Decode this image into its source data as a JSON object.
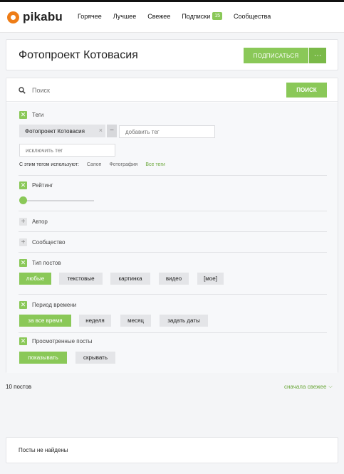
{
  "header": {
    "logo_text": "pikabu",
    "nav": [
      {
        "label": "Горячее"
      },
      {
        "label": "Лучшее"
      },
      {
        "label": "Свежее"
      },
      {
        "label": "Подписки",
        "badge": "15"
      },
      {
        "label": "Сообщества"
      }
    ]
  },
  "title_card": {
    "title": "Фотопроект Котовасия",
    "subscribe_label": "ПОДПИСАТЬСЯ",
    "more_label": "···"
  },
  "search": {
    "placeholder": "Поиск",
    "button_label": "ПОИСК"
  },
  "filters": {
    "tags": {
      "label": "Теги",
      "chip": "Фотопроект Котовасия",
      "chip_remove": "×",
      "minus": "−",
      "add_placeholder": "добавить тег",
      "exclude_placeholder": "исключить тег",
      "uses_label": "С этим тегом используют:",
      "uses_items": [
        "Сапоп",
        "Фотография"
      ],
      "all_tags": "Все теги"
    },
    "rating": {
      "label": "Рейтинг"
    },
    "author": {
      "label": "Автор"
    },
    "community": {
      "label": "Сообщество"
    },
    "post_type": {
      "label": "Тип постов",
      "options": [
        "любые",
        "текстовые",
        "картинка",
        "видео",
        "[мое]"
      ],
      "selected": "любые"
    },
    "period": {
      "label": "Период времени",
      "options": [
        "за все время",
        "неделя",
        "месяц",
        "задать даты"
      ],
      "selected": "за все время"
    },
    "viewed": {
      "label": "Просмотренные посты",
      "options": [
        "показывать",
        "скрывать"
      ],
      "selected": "показывать"
    }
  },
  "results": {
    "count": "10 постов",
    "sort": "сначала свежее",
    "empty": "Посты не найдены"
  },
  "colors": {
    "accent": "#8ac858",
    "link": "#6aa73a",
    "logo": "#ee7d17"
  }
}
